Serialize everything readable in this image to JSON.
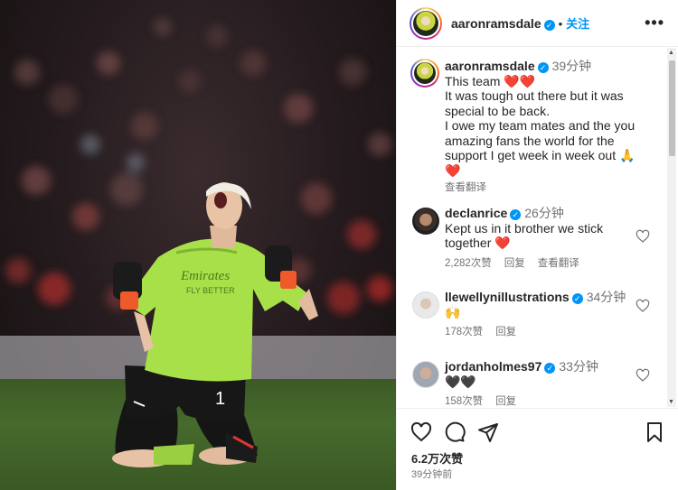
{
  "post": {
    "author": "aaronramsdale",
    "follow_label": "关注",
    "separator": "•",
    "more_label": "•••",
    "likes": "6.2万次赞",
    "time_ago": "39分钟前"
  },
  "caption": {
    "user": "aaronramsdale",
    "time": "39分钟",
    "lines": [
      "This team ❤️❤️",
      "It was tough out there but it was special to be back.",
      "I owe my team mates and the you amazing fans the world for the support I get week in week out 🙏",
      "❤️"
    ],
    "translate_label": "查看翻译"
  },
  "comments": [
    {
      "user": "declanrice",
      "time": "26分钟",
      "text": "Kept us in it brother we stick together ❤️",
      "likes": "2,282次赞",
      "reply_label": "回复",
      "translate_label": "查看翻译"
    },
    {
      "user": "llewellynillustrations",
      "time": "34分钟",
      "text": "🙌",
      "likes": "178次赞",
      "reply_label": "回复"
    },
    {
      "user": "jordanholmes97",
      "time": "33分钟",
      "text": "🖤🖤",
      "likes": "158次赞",
      "reply_label": "回复"
    }
  ],
  "icons": {
    "verified": "verified-badge-icon",
    "like": "heart-icon",
    "comment": "comment-icon",
    "share": "share-icon",
    "save": "bookmark-icon",
    "more": "more-options-icon"
  },
  "photo": {
    "jersey_text_1": "Emirates",
    "jersey_text_2": "FLY BETTER",
    "shirt_number": "1"
  },
  "colors": {
    "accent": "#0095f6",
    "heart": "#ed4956",
    "jersey": "#a8e04a",
    "secondary_text": "#737373"
  }
}
